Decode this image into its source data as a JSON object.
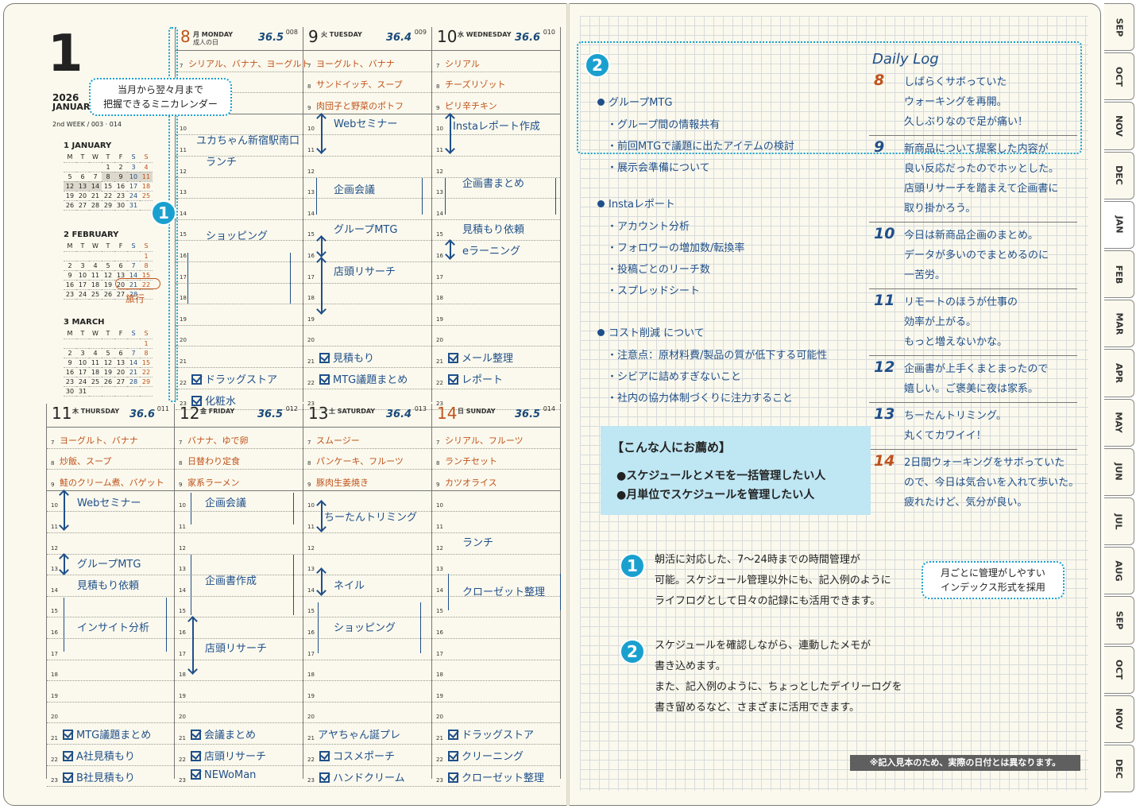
{
  "header": {
    "month_num": "1",
    "year": "2026",
    "month_name": "JANUARY",
    "week": "2nd WEEK / 003 · 014"
  },
  "mini_calendar": {
    "weekday_labels": [
      "M",
      "T",
      "W",
      "T",
      "F",
      "S",
      "S"
    ],
    "months": [
      {
        "title": "1 JANUARY",
        "rows": [
          [
            "",
            "",
            "1",
            "2",
            "3",
            "4"
          ],
          [
            "5",
            "6",
            "7",
            "8",
            "9",
            "10",
            "11"
          ],
          [
            "12",
            "13",
            "14",
            "15",
            "16",
            "17",
            "18"
          ],
          [
            "19",
            "20",
            "21",
            "22",
            "23",
            "24",
            "25"
          ],
          [
            "26",
            "27",
            "28",
            "29",
            "30",
            "31",
            ""
          ]
        ]
      },
      {
        "title": "2 FEBRUARY",
        "rows": [
          [
            "",
            "",
            "",
            "",
            "",
            "",
            "1"
          ],
          [
            "2",
            "3",
            "4",
            "5",
            "6",
            "7",
            "8"
          ],
          [
            "9",
            "10",
            "11",
            "12",
            "13",
            "14",
            "15"
          ],
          [
            "16",
            "17",
            "18",
            "19",
            "20",
            "21",
            "22"
          ],
          [
            "23",
            "24",
            "25",
            "26",
            "27",
            "28",
            ""
          ]
        ]
      },
      {
        "title": "3 MARCH",
        "rows": [
          [
            "",
            "",
            "",
            "",
            "",
            "",
            "1"
          ],
          [
            "2",
            "3",
            "4",
            "5",
            "6",
            "7",
            "8"
          ],
          [
            "9",
            "10",
            "11",
            "12",
            "13",
            "14",
            "15"
          ],
          [
            "16",
            "17",
            "18",
            "19",
            "20",
            "21",
            "22"
          ],
          [
            "23",
            "24",
            "25",
            "26",
            "27",
            "28",
            "29"
          ],
          [
            "30",
            "31",
            "",
            "",
            "",
            "",
            ""
          ]
        ]
      }
    ],
    "travel_note": "旅行"
  },
  "callouts": {
    "mini_cal": "当月から翌々月まで\n把握できるミニカレンダー",
    "index": "月ごとに管理がしやすい\nインデックス形式を採用"
  },
  "days": [
    {
      "num": "8",
      "name": "月 MONDAY",
      "holiday": "成人の日",
      "temp": "36.5",
      "count": "008",
      "meals": [
        "シリアル、バナナ、ヨーグルト",
        "",
        ""
      ],
      "sched": [
        {
          "t": "ユカちゃん新宿駅南口",
          "r": 11
        },
        {
          "t": "ランチ",
          "r": 12
        },
        {
          "t": "ショッピング",
          "r": 15.5
        }
      ],
      "checks": [
        "ドラッグストア",
        "化粧水"
      ]
    },
    {
      "num": "9",
      "name": "火 TUESDAY",
      "holiday": "",
      "temp": "36.4",
      "count": "009",
      "meals": [
        "ヨーグルト、バナナ",
        "サンドイッチ、スープ",
        "肉団子と野菜のポトフ"
      ],
      "sched": [
        {
          "t": "Webセミナー",
          "r": 10.2
        },
        {
          "t": "企画会議",
          "r": 13.3
        },
        {
          "t": "グループMTG",
          "r": 15.2
        },
        {
          "t": "店頭リサーチ",
          "r": 17.2
        }
      ],
      "checks": [
        "見積もり",
        "MTG議題まとめ"
      ]
    },
    {
      "num": "10",
      "name": "水 WEDNESDAY",
      "holiday": "",
      "temp": "36.6",
      "count": "010",
      "meals": [
        "シリアル",
        "チーズリゾット",
        "ピリ辛チキン"
      ],
      "sched": [
        {
          "t": "Instaレポート作成",
          "r": 10.3
        },
        {
          "t": "企画書まとめ",
          "r": 13
        },
        {
          "t": "見積もり依頼",
          "r": 15.2
        },
        {
          "t": "eラーニング",
          "r": 16.2
        }
      ],
      "checks": [
        "メール整理",
        "レポート"
      ]
    },
    {
      "num": "11",
      "name": "木 THURSDAY",
      "holiday": "",
      "temp": "36.6",
      "count": "011",
      "meals": [
        "ヨーグルト、バナナ",
        "炒飯、スープ",
        "鮭のクリーム煮、バゲット"
      ],
      "sched": [
        {
          "t": "Webセミナー",
          "r": 10.3
        },
        {
          "t": "グループMTG",
          "r": 13.2
        },
        {
          "t": "見積もり依頼",
          "r": 14.2
        },
        {
          "t": "インサイト分析",
          "r": 16.2
        }
      ],
      "checks": [
        "MTG議題まとめ",
        "A社見積もり",
        "B社見積もり"
      ]
    },
    {
      "num": "12",
      "name": "金 FRIDAY",
      "holiday": "",
      "temp": "36.5",
      "count": "012",
      "meals": [
        "バナナ、ゆで卵",
        "日替わり定食",
        "家系ラーメン"
      ],
      "sched": [
        {
          "t": "企画会議",
          "r": 10.3
        },
        {
          "t": "企画書作成",
          "r": 14
        },
        {
          "t": "店頭リサーチ",
          "r": 17.2
        }
      ],
      "checks": [
        "会議まとめ",
        "店頭リサーチ",
        "NEWoMan"
      ]
    },
    {
      "num": "13",
      "name": "土 SATURDAY",
      "holiday": "",
      "temp": "36.4",
      "count": "013",
      "meals": [
        "スムージー",
        "パンケーキ、フルーツ",
        "豚肉生姜焼き"
      ],
      "sched": [
        {
          "t": "ちーたんトリミング",
          "r": 11
        },
        {
          "t": "ネイル",
          "r": 14.2
        },
        {
          "t": "ショッピング",
          "r": 16.2
        }
      ],
      "checks": [
        "アヤちゃん誕プレ",
        "コスメポーチ",
        "ハンドクリーム"
      ]
    },
    {
      "num": "14",
      "name": "日 SUNDAY",
      "holiday": "",
      "temp": "36.5",
      "count": "014",
      "meals": [
        "シリアル、フルーツ",
        "ランチセット",
        "カツオライス"
      ],
      "sched": [
        {
          "t": "ランチ",
          "r": 12.2
        },
        {
          "t": "クローゼット整理",
          "r": 14.5
        }
      ],
      "checks": [
        "ドラッグストア",
        "クリーニング",
        "クローゼット整理"
      ]
    }
  ],
  "memo": {
    "groups": [
      {
        "title": "グループMTG",
        "items": [
          "・グループ間の情報共有",
          "・前回MTGで議題に出たアイテムの検討",
          "・展示会準備について"
        ]
      },
      {
        "title": "Instaレポート",
        "items": [
          "・アカウント分析",
          "・フォロワーの増加数/転換率",
          "・投稿ごとのリーチ数",
          "・スプレッドシート"
        ]
      },
      {
        "title": "コスト削減 について",
        "items": [
          "・注意点：原材料費/製品の質が低下する可能性",
          "・シビアに詰めすぎないこと",
          "・社内の協力体制づくりに注力すること"
        ]
      }
    ]
  },
  "daily_log": {
    "title": "Daily Log",
    "entries": [
      {
        "d": "8",
        "lines": [
          "しばらくサボっていた",
          "ウォーキングを再開。",
          "久しぶりなので足が痛い！"
        ]
      },
      {
        "d": "9",
        "lines": [
          "新商品について提案した内容が",
          "良い反応だったのでホッとした。",
          "店頭リサーチを踏まえて企画書に",
          "取り掛かろう。"
        ]
      },
      {
        "d": "10",
        "lines": [
          "今日は新商品企画のまとめ。",
          "データが多いのでまとめるのに",
          "一苦労。"
        ]
      },
      {
        "d": "11",
        "lines": [
          "リモートのほうが仕事の",
          "効率が上がる。",
          "もっと増えないかな。"
        ]
      },
      {
        "d": "12",
        "lines": [
          "企画書が上手くまとまったので",
          "嬉しい。ご褒美に夜は家系。"
        ]
      },
      {
        "d": "13",
        "lines": [
          "ちーたんトリミング。",
          "丸くてカワイイ！"
        ]
      },
      {
        "d": "14",
        "lines": [
          "2日間ウォーキングをサボっていた",
          "ので、今日は気合いを入れて歩いた。",
          "疲れたけど、気分が良い。"
        ]
      }
    ]
  },
  "recommend": {
    "title": "【こんな人にお薦め】",
    "items": [
      "●スケジュールとメモを一括管理したい人",
      "●月単位でスケジュールを管理したい人"
    ]
  },
  "explain": [
    {
      "num": "1",
      "lines": [
        "朝活に対応した、7〜24時までの時間管理が",
        "可能。スケジュール管理以外にも、記入例のように",
        "ライフログとして日々の記録にも活用できます。"
      ]
    },
    {
      "num": "2",
      "lines": [
        "スケジュールを確認しながら、連動したメモが",
        "書き込めます。",
        "また、記入例のように、ちょっとしたデイリーログを",
        "書き留めるなど、さまざまに活用できます。"
      ]
    }
  ],
  "note": "※記入見本のため、実際の日付とは異なります。",
  "badges": {
    "b1": "1",
    "b2": "2"
  },
  "tabs": [
    "SEP",
    "OCT",
    "NOV",
    "DEC",
    "JAN",
    "FEB",
    "MAR",
    "APR",
    "MAY",
    "JUN",
    "JUL",
    "AUG",
    "SEP",
    "OCT",
    "NOV",
    "DEC"
  ],
  "colors": {
    "accent": "#1aa0cf",
    "ink": "#1f4f8a",
    "meal": "#c0521b",
    "paper": "#fbf9ed"
  }
}
